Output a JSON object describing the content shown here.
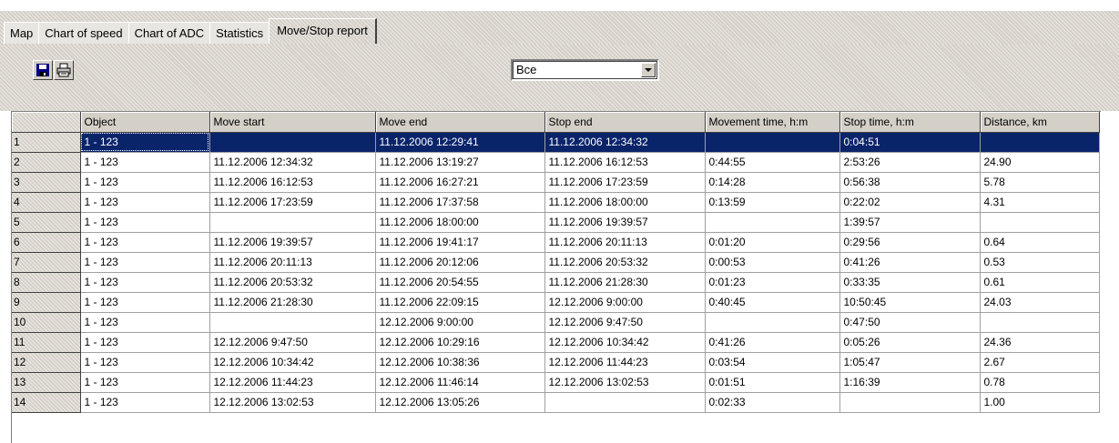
{
  "tabs": [
    {
      "label": "Map"
    },
    {
      "label": "Chart of speed"
    },
    {
      "label": "Chart of ADC"
    },
    {
      "label": "Statistics"
    },
    {
      "label": "Move/Stop report",
      "active": true
    }
  ],
  "toolbar": {
    "save_icon": "floppy-disk-icon",
    "print_icon": "printer-icon"
  },
  "filter": {
    "selected": "Все"
  },
  "grid": {
    "columns": [
      "Object",
      "Move start",
      "Move end",
      "Stop end",
      "Movement time, h:m",
      "Stop time, h:m",
      "Distance, km"
    ],
    "rows": [
      {
        "n": "1",
        "cells": [
          "1 - 123",
          "",
          "11.12.2006 12:29:41",
          "11.12.2006 12:34:32",
          "",
          "0:04:51",
          ""
        ]
      },
      {
        "n": "2",
        "cells": [
          "1 - 123",
          "11.12.2006 12:34:32",
          "11.12.2006 13:19:27",
          "11.12.2006 16:12:53",
          "0:44:55",
          "2:53:26",
          "24.90"
        ]
      },
      {
        "n": "3",
        "cells": [
          "1 - 123",
          "11.12.2006 16:12:53",
          "11.12.2006 16:27:21",
          "11.12.2006 17:23:59",
          "0:14:28",
          "0:56:38",
          "5.78"
        ]
      },
      {
        "n": "4",
        "cells": [
          "1 - 123",
          "11.12.2006 17:23:59",
          "11.12.2006 17:37:58",
          "11.12.2006 18:00:00",
          "0:13:59",
          "0:22:02",
          "4.31"
        ]
      },
      {
        "n": "5",
        "cells": [
          "1 - 123",
          "",
          "11.12.2006 18:00:00",
          "11.12.2006 19:39:57",
          "",
          "1:39:57",
          ""
        ]
      },
      {
        "n": "6",
        "cells": [
          "1 - 123",
          "11.12.2006 19:39:57",
          "11.12.2006 19:41:17",
          "11.12.2006 20:11:13",
          "0:01:20",
          "0:29:56",
          "0.64"
        ]
      },
      {
        "n": "7",
        "cells": [
          "1 - 123",
          "11.12.2006 20:11:13",
          "11.12.2006 20:12:06",
          "11.12.2006 20:53:32",
          "0:00:53",
          "0:41:26",
          "0.53"
        ]
      },
      {
        "n": "8",
        "cells": [
          "1 - 123",
          "11.12.2006 20:53:32",
          "11.12.2006 20:54:55",
          "11.12.2006 21:28:30",
          "0:01:23",
          "0:33:35",
          "0.61"
        ]
      },
      {
        "n": "9",
        "cells": [
          "1 - 123",
          "11.12.2006 21:28:30",
          "11.12.2006 22:09:15",
          "12.12.2006 9:00:00",
          "0:40:45",
          "10:50:45",
          "24.03"
        ]
      },
      {
        "n": "10",
        "cells": [
          "1 - 123",
          "",
          "12.12.2006 9:00:00",
          "12.12.2006 9:47:50",
          "",
          "0:47:50",
          ""
        ]
      },
      {
        "n": "11",
        "cells": [
          "1 - 123",
          "12.12.2006 9:47:50",
          "12.12.2006 10:29:16",
          "12.12.2006 10:34:42",
          "0:41:26",
          "0:05:26",
          "24.36"
        ]
      },
      {
        "n": "12",
        "cells": [
          "1 - 123",
          "12.12.2006 10:34:42",
          "12.12.2006 10:38:36",
          "12.12.2006 11:44:23",
          "0:03:54",
          "1:05:47",
          "2.67"
        ]
      },
      {
        "n": "13",
        "cells": [
          "1 - 123",
          "12.12.2006 11:44:23",
          "12.12.2006 11:46:14",
          "12.12.2006 13:02:53",
          "0:01:51",
          "1:16:39",
          "0.78"
        ]
      },
      {
        "n": "14",
        "cells": [
          "1 - 123",
          "12.12.2006 13:02:53",
          "12.12.2006 13:05:26",
          "",
          "0:02:33",
          "",
          "1.00"
        ]
      }
    ]
  }
}
